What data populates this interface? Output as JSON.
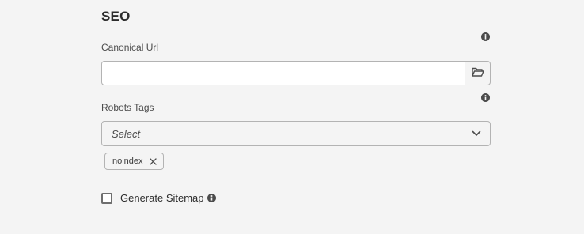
{
  "section": {
    "title": "SEO"
  },
  "canonical_url": {
    "label": "Canonical Url",
    "value": "",
    "placeholder": "",
    "info_icon": "info-icon",
    "browse_icon": "folder-open-icon"
  },
  "robots_tags": {
    "label": "Robots Tags",
    "placeholder": "Select",
    "info_icon": "info-icon",
    "dropdown_icon": "chevron-down-icon",
    "selected_tags": [
      {
        "label": "noindex",
        "remove_icon": "close-icon"
      }
    ]
  },
  "generate_sitemap": {
    "label": "Generate Sitemap",
    "checked": false,
    "info_icon": "info-icon"
  },
  "colors": {
    "background": "#f4f4f4",
    "input_background": "#ffffff",
    "border": "#b3b3b3",
    "text": "#2c2c2c",
    "icon": "#4b4b4b"
  }
}
